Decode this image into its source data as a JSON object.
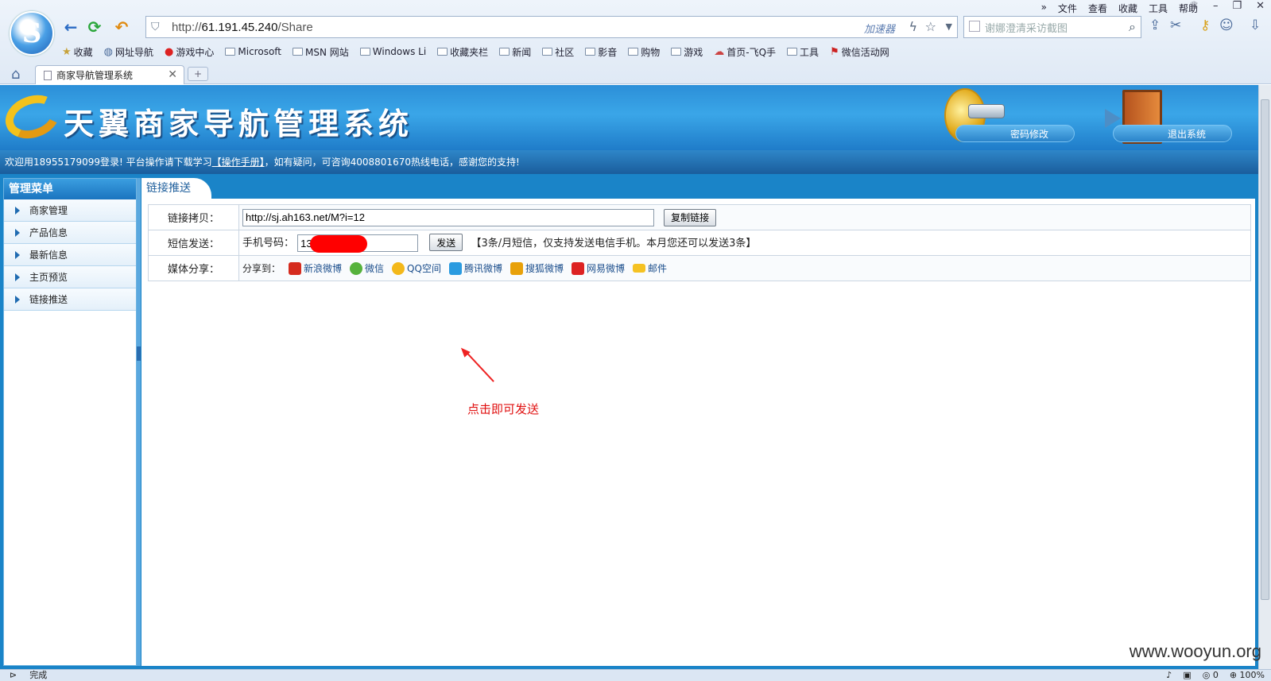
{
  "browser": {
    "address_url_prefix": "http://",
    "address_url_host": "61.191.45.240",
    "address_url_path": "/Share",
    "accelerator_label": "加速器",
    "search_placeholder": "谢娜澄清采访截图",
    "menu": [
      "文件",
      "查看",
      "收藏",
      "工具",
      "帮助"
    ],
    "menu_more": "»",
    "bookmarks": [
      {
        "label": "收藏",
        "icon": "star-icon"
      },
      {
        "label": "网址导航",
        "icon": "globe-icon"
      },
      {
        "label": "游戏中心",
        "icon": "game-icon"
      },
      {
        "label": "Microsoft",
        "icon": "folder-icon"
      },
      {
        "label": "MSN 网站",
        "icon": "folder-icon"
      },
      {
        "label": "Windows Li",
        "icon": "folder-icon"
      },
      {
        "label": "收藏夹栏",
        "icon": "folder-icon"
      },
      {
        "label": "新闻",
        "icon": "folder-icon"
      },
      {
        "label": "社区",
        "icon": "folder-icon"
      },
      {
        "label": "影音",
        "icon": "folder-icon"
      },
      {
        "label": "购物",
        "icon": "folder-icon"
      },
      {
        "label": "游戏",
        "icon": "folder-icon"
      },
      {
        "label": "首页-飞Q手",
        "icon": "cloud-icon"
      },
      {
        "label": "工具",
        "icon": "folder-icon"
      },
      {
        "label": "微信活动网",
        "icon": "gift-icon"
      }
    ],
    "tab_title": "商家导航管理系统",
    "new_tab_label": "+",
    "status_left": "完成",
    "status_count": "0",
    "status_zoom": "100%"
  },
  "header": {
    "title": "天翼商家导航管理系统",
    "password_btn": "密码修改",
    "logout_btn": "退出系统"
  },
  "welcome": {
    "part1": "欢迎用18955179099登录!  平台操作请下载学习",
    "manual_link": "【操作手册】",
    "part2": "，如有疑问，可咨询4008801670热线电话，感谢您的支持!"
  },
  "sidebar": {
    "title": "管理菜单",
    "items": [
      {
        "label": "商家管理"
      },
      {
        "label": "产品信息"
      },
      {
        "label": "最新信息"
      },
      {
        "label": "主页预览"
      },
      {
        "label": "链接推送"
      }
    ]
  },
  "content": {
    "tab_label": "链接推送",
    "link_copy_label": "链接拷贝：",
    "link_value": "http://sj.ah163.net/M?i=12",
    "copy_btn": "复制链接",
    "sms_label": "短信发送：",
    "phone_label": "手机号码：",
    "phone_value": "13",
    "send_btn": "发送",
    "sms_note": "【3条/月短信，仅支持发送电信手机。本月您还可以发送3条】",
    "media_label": "媒体分享：",
    "share_prefix": "分享到：",
    "share_items": [
      {
        "label": "新浪微博",
        "icon": "sina-weibo-icon",
        "color": "#d52b1e"
      },
      {
        "label": "微信",
        "icon": "wechat-icon",
        "color": "#56b23c"
      },
      {
        "label": "QQ空间",
        "icon": "qzone-icon",
        "color": "#f3b81a"
      },
      {
        "label": "腾讯微博",
        "icon": "tencent-weibo-icon",
        "color": "#2a9be0"
      },
      {
        "label": "搜狐微博",
        "icon": "sohu-weibo-icon",
        "color": "#e8a10a"
      },
      {
        "label": "网易微博",
        "icon": "netease-weibo-icon",
        "color": "#d22"
      },
      {
        "label": "邮件",
        "icon": "mail-icon",
        "color": "#f5c223"
      }
    ]
  },
  "annotation": {
    "text": "点击即可发送"
  },
  "watermark": "www.wooyun.org"
}
